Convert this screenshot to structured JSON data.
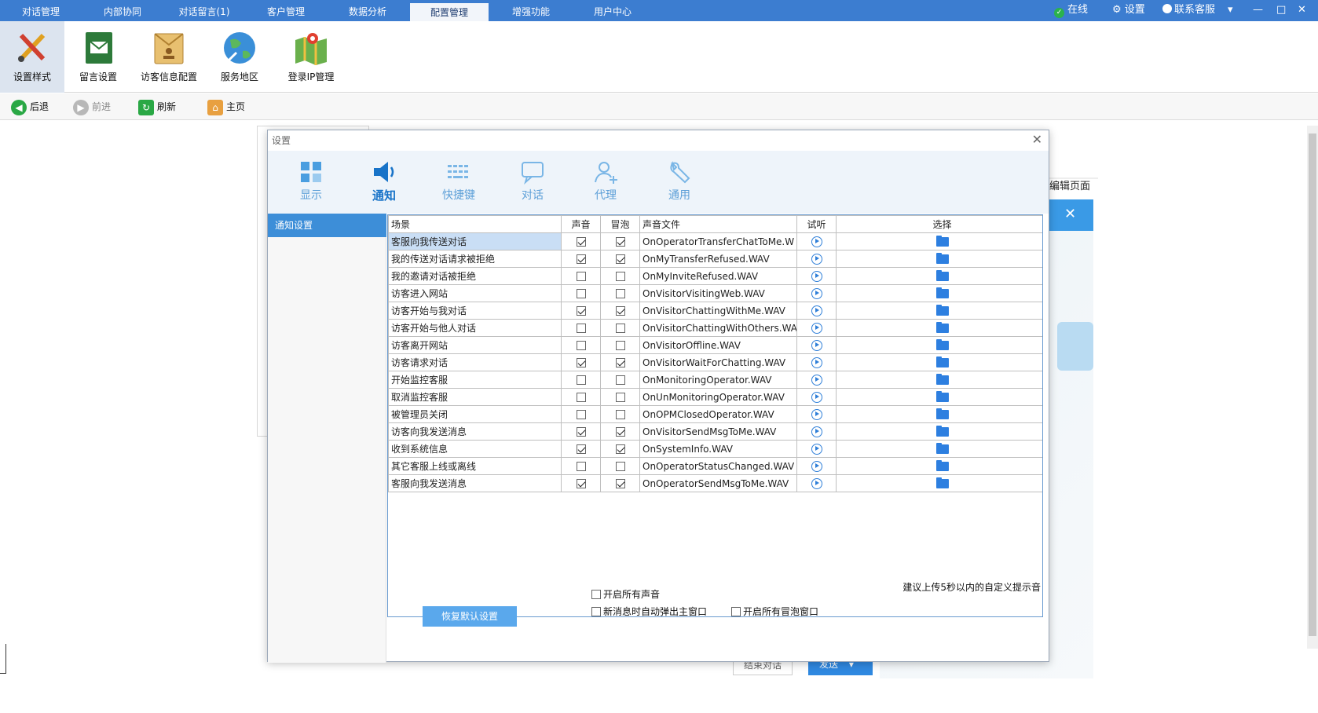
{
  "topbar": {
    "tabs": [
      "对话管理",
      "内部协同",
      "对话留言(1)",
      "客户管理",
      "数据分析",
      "配置管理",
      "增强功能",
      "用户中心"
    ],
    "active_tab": "配置管理",
    "online_label": "在线",
    "settings_label": "设置",
    "support_label": "联系客服"
  },
  "ribbon": {
    "items": [
      "设置样式",
      "留言设置",
      "访客信息配置",
      "服务地区",
      "登录IP管理"
    ],
    "active_item": "设置样式"
  },
  "navbar": {
    "back": "后退",
    "forward": "前进",
    "refresh": "刷新",
    "home": "主页"
  },
  "background": {
    "edit_page_label": "编辑页面",
    "end_chat": "结束对话",
    "send": "发送"
  },
  "dialog": {
    "title": "设置",
    "tabs": [
      "显示",
      "通知",
      "快捷键",
      "对话",
      "代理",
      "通用"
    ],
    "active_tab": "通知",
    "sidebar_item": "通知设置",
    "columns": [
      "场景",
      "声音",
      "冒泡",
      "声音文件",
      "试听",
      "选择"
    ],
    "rows": [
      {
        "scene": "客服向我传送对话",
        "sound": true,
        "bubble": true,
        "file": "OnOperatorTransferChatToMe.W"
      },
      {
        "scene": "我的传送对话请求被拒绝",
        "sound": true,
        "bubble": true,
        "file": "OnMyTransferRefused.WAV"
      },
      {
        "scene": "我的邀请对话被拒绝",
        "sound": false,
        "bubble": false,
        "file": "OnMyInviteRefused.WAV"
      },
      {
        "scene": "访客进入网站",
        "sound": false,
        "bubble": false,
        "file": "OnVisitorVisitingWeb.WAV"
      },
      {
        "scene": "访客开始与我对话",
        "sound": true,
        "bubble": true,
        "file": "OnVisitorChattingWithMe.WAV"
      },
      {
        "scene": "访客开始与他人对话",
        "sound": false,
        "bubble": false,
        "file": "OnVisitorChattingWithOthers.WA"
      },
      {
        "scene": "访客离开网站",
        "sound": false,
        "bubble": false,
        "file": "OnVisitorOffline.WAV"
      },
      {
        "scene": "访客请求对话",
        "sound": true,
        "bubble": true,
        "file": "OnVisitorWaitForChatting.WAV"
      },
      {
        "scene": "开始监控客服",
        "sound": false,
        "bubble": false,
        "file": "OnMonitoringOperator.WAV"
      },
      {
        "scene": "取消监控客服",
        "sound": false,
        "bubble": false,
        "file": "OnUnMonitoringOperator.WAV"
      },
      {
        "scene": "被管理员关闭",
        "sound": false,
        "bubble": false,
        "file": "OnOPMClosedOperator.WAV"
      },
      {
        "scene": "访客向我发送消息",
        "sound": true,
        "bubble": true,
        "file": "OnVisitorSendMsgToMe.WAV"
      },
      {
        "scene": "收到系统信息",
        "sound": true,
        "bubble": true,
        "file": "OnSystemInfo.WAV"
      },
      {
        "scene": "其它客服上线或离线",
        "sound": false,
        "bubble": false,
        "file": "OnOperatorStatusChanged.WAV"
      },
      {
        "scene": "客服向我发送消息",
        "sound": true,
        "bubble": true,
        "file": "OnOperatorSendMsgToMe.WAV"
      }
    ],
    "hint": "建议上传5秒以内的自定义提示音",
    "restore_button": "恢复默认设置",
    "options": {
      "enable_all_sounds": "开启所有声音",
      "auto_popup": "新消息时自动弹出主窗口",
      "enable_all_bubbles": "开启所有冒泡窗口"
    }
  }
}
